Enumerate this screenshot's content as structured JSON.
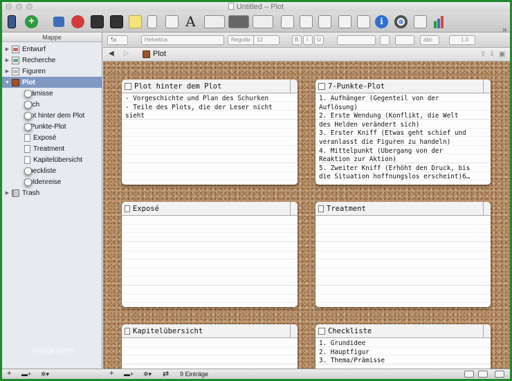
{
  "window": {
    "title": "Untitled – Plot"
  },
  "sidebar": {
    "header": "Mappe",
    "items": [
      {
        "label": "Entwurf",
        "icon": "draft-folder-icon"
      },
      {
        "label": "Recherche",
        "icon": "research-folder-icon"
      },
      {
        "label": "Figuren",
        "icon": "characters-folder-icon"
      },
      {
        "label": "Plot",
        "icon": "plot-notebook-icon",
        "selected": true
      },
      {
        "label": "Prämisse",
        "icon": "index-card-icon"
      },
      {
        "label": "Pitch",
        "icon": "index-card-icon"
      },
      {
        "label": "Plot hinter dem Plot",
        "icon": "index-card-icon"
      },
      {
        "label": "7-Punkte-Plot",
        "icon": "index-card-icon"
      },
      {
        "label": "Exposé",
        "icon": "document-icon"
      },
      {
        "label": "Treatment",
        "icon": "document-icon"
      },
      {
        "label": "Kapitelübersicht",
        "icon": "document-icon"
      },
      {
        "label": "Checkliste",
        "icon": "index-card-icon"
      },
      {
        "label": "Heldenreise",
        "icon": "index-card-icon"
      },
      {
        "label": "Trash",
        "icon": "trash-icon"
      }
    ],
    "watermark": "Vorlage Ideen",
    "footer": {
      "add": "+",
      "add_folder": "▬+",
      "gear": "✲▾"
    }
  },
  "formatbar": {
    "style": "¶a",
    "font": "Helvetica",
    "weight": "Regulär",
    "size": "12",
    "bold": "B",
    "italic": "I",
    "underline": "U",
    "highlight": "abc",
    "line_spacing": "1.0"
  },
  "header": {
    "title": "Plot"
  },
  "cards": [
    {
      "title": "Plot hinter dem Plot",
      "lines": [
        "- Vorgeschichte und Plan des Schurken",
        "- Teile des Plots, die der Leser nicht",
        "sieht"
      ]
    },
    {
      "title": "7-Punkte-Plot",
      "lines": [
        "1. Aufhänger (Gegenteil von der",
        "Auflösung)",
        "2. Erste Wendung (Konflikt, die Welt",
        "des Helden verändert sich)",
        "3. Erster Kniff (Etwas geht schief und",
        "veranlasst die Figuren zu handeln)",
        "4. Mittelpunkt (Übergang von der",
        "Reaktion zur Aktion)",
        "5. Zweiter Kniff (Erhöht den Druck, bis",
        "die Situation hoffnungslos erscheint)6…"
      ]
    },
    {
      "title": "Exposé",
      "lines": []
    },
    {
      "title": "Treatment",
      "lines": []
    },
    {
      "title": "Kapitelübersicht",
      "lines": []
    },
    {
      "title": "Checkliste",
      "lines": [
        "1. Grundidee",
        "2. Hauptfigur",
        "3. Thema/Prämisse"
      ]
    }
  ],
  "statusbar": {
    "add": "+",
    "add_folder": "▬+",
    "gear": "✲▾",
    "swap": "⇄",
    "count": "9 Einträge"
  }
}
